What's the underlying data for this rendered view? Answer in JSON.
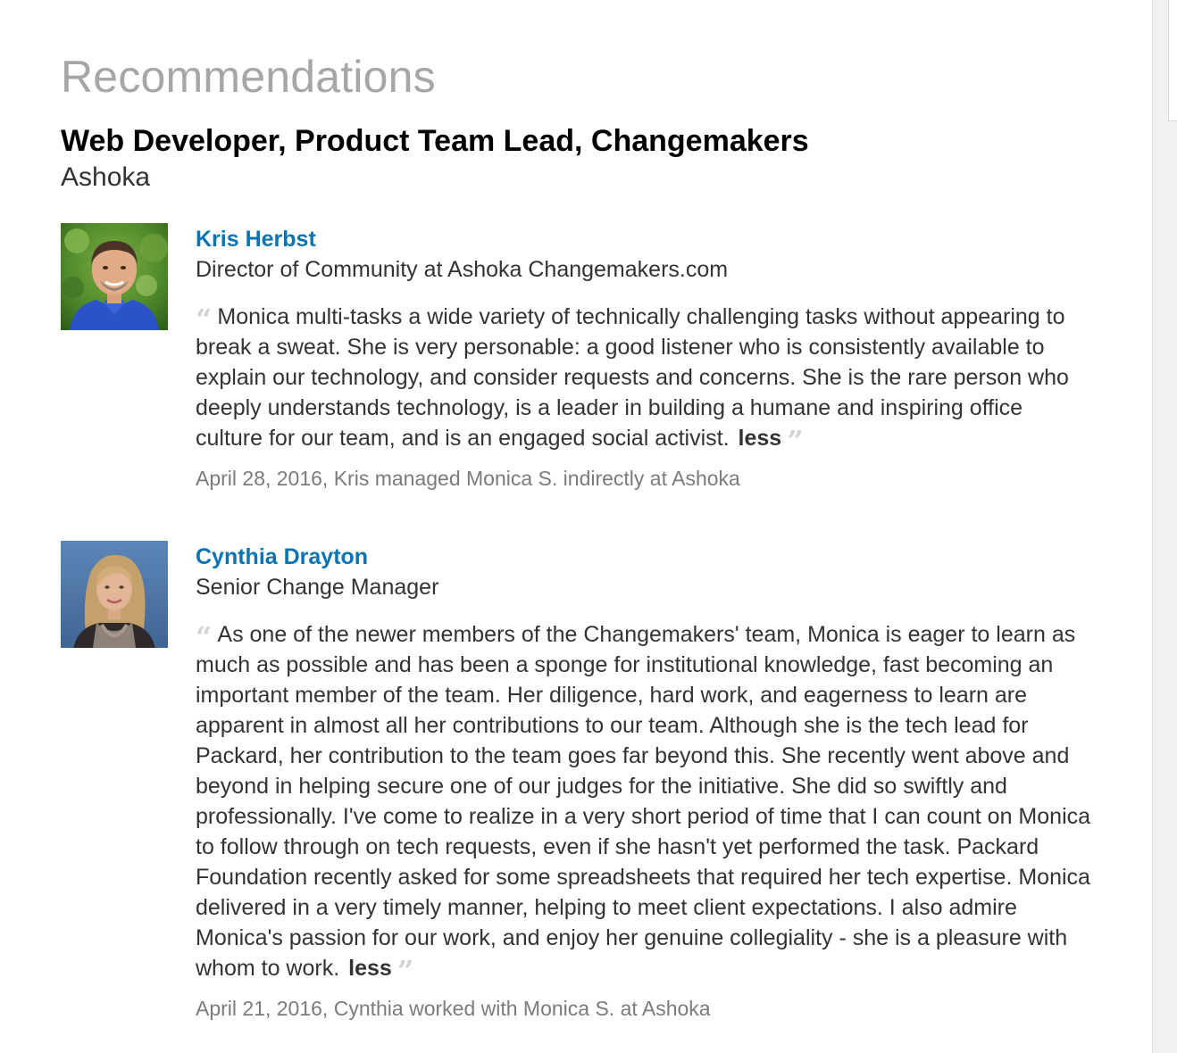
{
  "section": {
    "title": "Recommendations"
  },
  "position": {
    "title": "Web Developer, Product Team Lead, Changemakers",
    "company": "Ashoka"
  },
  "recommendations": [
    {
      "name": "Kris Herbst",
      "headline": "Director of Community at Ashoka Changemakers.com",
      "text": "Monica multi-tasks a wide variety of technically challenging tasks without appearing to break a sweat. She is very personable: a good listener who is consistently available to explain our technology, and consider requests and concerns. She is the rare person who deeply understands technology, is a leader in building a humane and inspiring office culture for our team, and is an engaged social activist.",
      "less_label": "less",
      "meta": "April 28, 2016, Kris managed Monica S. indirectly at Ashoka",
      "photo_icon": "profile-photo-man-blue-shirt"
    },
    {
      "name": "Cynthia Drayton",
      "headline": "Senior Change Manager",
      "text": "As one of the newer members of the Changemakers' team, Monica is eager to learn as much as possible and has been a sponge for institutional knowledge, fast becoming an important member of the team. Her diligence, hard work, and eagerness to learn are apparent in almost all her contributions to our team. Although she is the tech lead for Packard, her contribution to the team goes far beyond this. She recently went above and beyond in helping secure one of our judges for the initiative. She did so swiftly and professionally. I've come to realize in a very short period of time that I can count on Monica to follow through on tech requests, even if she hasn't yet performed the task. Packard Foundation recently asked for some spreadsheets that required her tech expertise. Monica delivered in a very timely manner, helping to meet client expectations. I also admire Monica's passion for our work, and enjoy her genuine collegiality - she is a pleasure with whom to work.",
      "less_label": "less",
      "meta": "April 21, 2016, Cynthia worked with Monica S. at Ashoka",
      "photo_icon": "profile-photo-woman-blue-background"
    }
  ],
  "colors": {
    "name_link": "#0a73b3",
    "section_title": "#a6a6a6",
    "meta_text": "#7b7b7b",
    "quote_marks": "#d3d3d3"
  }
}
